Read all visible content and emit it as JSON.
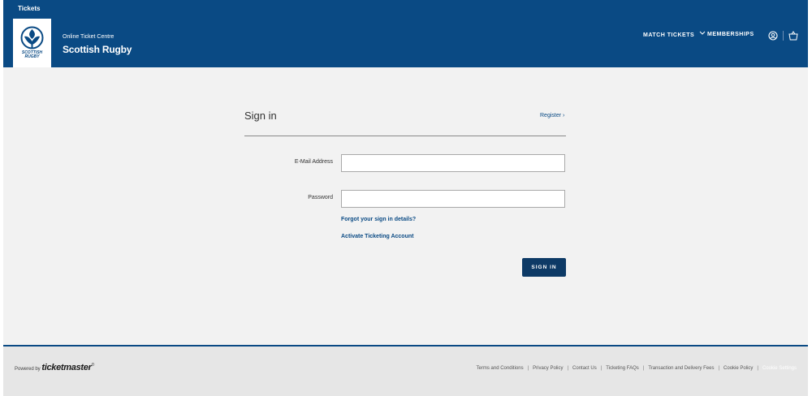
{
  "header": {
    "top_label": "Tickets",
    "subtitle": "Online Ticket Centre",
    "brand": "Scottish Rugby",
    "logo_text_line1": "SCOTTISH",
    "logo_text_line2": "RUGBY",
    "nav": {
      "match_tickets": "MATCH TICKETS",
      "memberships": "MEMBERSHIPS"
    },
    "colors": {
      "primary": "#0a4a84",
      "button": "#0d3a66"
    }
  },
  "signin": {
    "title": "Sign in",
    "register": "Register ›",
    "email_label": "E-Mail Address",
    "email_value": "",
    "password_label": "Password",
    "password_value": "",
    "forgot": "Forgot your sign in details?",
    "activate": "Activate Ticketing Account",
    "button": "SIGN IN"
  },
  "footer": {
    "powered_by": "Powered by",
    "powered_brand": "ticketmaster",
    "powered_mark": "®",
    "links": [
      "Terms and Conditions",
      "Privacy Policy",
      "Contact Us",
      "Ticketing FAQs",
      "Transaction and Delivery Fees",
      "Cookie Policy",
      "Cookie Settings"
    ]
  }
}
